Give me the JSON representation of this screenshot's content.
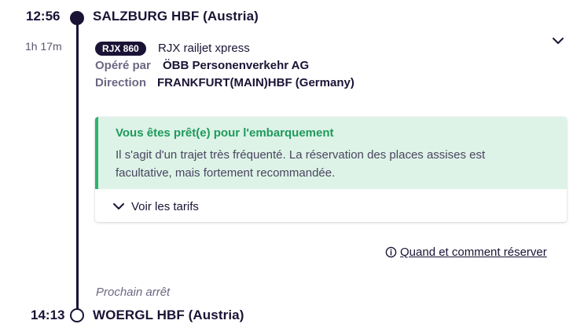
{
  "departure": {
    "time": "12:56",
    "station": "SALZBURG HBF (Austria)"
  },
  "duration": "1h 17m",
  "train": {
    "badge": "RJX 860",
    "service_name": "RJX railjet xpress",
    "operator_label": "Opéré par",
    "operator_value": "ÖBB Personenverkehr AG",
    "direction_label": "Direction",
    "direction_value": "FRANKFURT(MAIN)HBF (Germany)"
  },
  "notice": {
    "title": "Vous êtes prêt(e) pour l'embarquement",
    "line1": "Il s'agit d'un trajet très fréquenté. La réservation des places assises est",
    "line2": "facultative, mais fortement recommandée.",
    "accent_color": "#2eb36e",
    "background_color": "#ddf3e7"
  },
  "fares_toggle_label": "Voir les tarifs",
  "booking_link_label": "Quand et comment réserver",
  "next_stop_label": "Prochain arrêt",
  "arrival": {
    "time": "14:13",
    "station": "WOERGL HBF (Austria)"
  },
  "icons": {
    "expand": "chevron-down-icon",
    "fares": "chevron-down-icon",
    "info": "info-circle-icon"
  },
  "colors": {
    "primary": "#1b1335",
    "muted": "#6d6783"
  }
}
